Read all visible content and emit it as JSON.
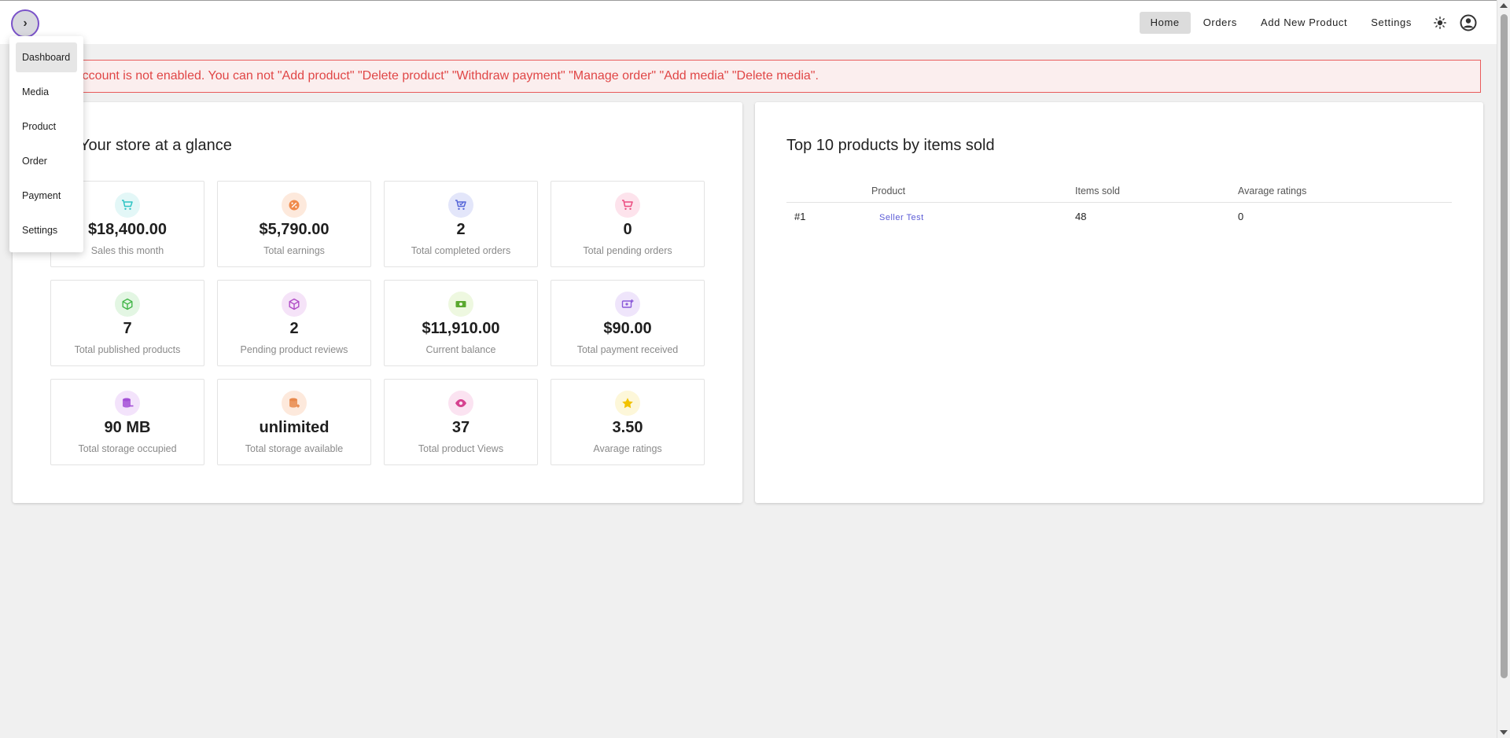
{
  "topbar": {
    "nav": [
      {
        "label": "Home",
        "active": true
      },
      {
        "label": "Orders",
        "active": false
      },
      {
        "label": "Add New Product",
        "active": false
      },
      {
        "label": "Settings",
        "active": false
      }
    ],
    "toggle_glyph": "›"
  },
  "side_menu": {
    "items": [
      "Dashboard",
      "Media",
      "Product",
      "Order",
      "Payment",
      "Settings"
    ]
  },
  "alert": {
    "text": "Your account is not enabled. You can not \"Add product\" \"Delete product\" \"Withdraw payment\" \"Manage order\" \"Add media\" \"Delete media\"."
  },
  "glance": {
    "title": "Your store at a glance",
    "stats": [
      {
        "value": "$18,400.00",
        "label": "Sales this month",
        "icon": "cart-icon",
        "color": "#2ec4c4",
        "bg": "#e3f7f7"
      },
      {
        "value": "$5,790.00",
        "label": "Total earnings",
        "icon": "percent-icon",
        "color": "#f08a4b",
        "bg": "#fde9dc"
      },
      {
        "value": "2",
        "label": "Total completed orders",
        "icon": "cart-check-icon",
        "color": "#5565d8",
        "bg": "#e3e6fa"
      },
      {
        "value": "0",
        "label": "Total pending orders",
        "icon": "cart-icon",
        "color": "#ec4b7f",
        "bg": "#fde3ec"
      },
      {
        "value": "7",
        "label": "Total published products",
        "icon": "box-icon",
        "color": "#43b649",
        "bg": "#e3f6e3"
      },
      {
        "value": "2",
        "label": "Pending product reviews",
        "icon": "box-icon",
        "color": "#b04cc6",
        "bg": "#f5e3f8"
      },
      {
        "value": "$11,910.00",
        "label": "Current balance",
        "icon": "cash-icon",
        "color": "#5aa82f",
        "bg": "#eef8e0"
      },
      {
        "value": "$90.00",
        "label": "Total payment received",
        "icon": "cash-plus-icon",
        "color": "#8b5bd9",
        "bg": "#efe5fb"
      },
      {
        "value": "90 MB",
        "label": "Total storage occupied",
        "icon": "database-icon",
        "color": "#a34fd6",
        "bg": "#f3e3fb"
      },
      {
        "value": "unlimited",
        "label": "Total storage available",
        "icon": "database-plus-icon",
        "color": "#e8894c",
        "bg": "#fde9dc"
      },
      {
        "value": "37",
        "label": "Total product Views",
        "icon": "eye-icon",
        "color": "#d6418f",
        "bg": "#fbe3f1"
      },
      {
        "value": "3.50",
        "label": "Avarage ratings",
        "icon": "star-icon",
        "color": "#f2c200",
        "bg": "#fdf7d9"
      }
    ]
  },
  "top_products": {
    "title": "Top 10 products by items sold",
    "columns": [
      "",
      "Product",
      "Items sold",
      "Avarage ratings"
    ],
    "rows": [
      {
        "rank": "#1",
        "product": "Seller Test",
        "items_sold": "48",
        "ratings": "0"
      }
    ]
  }
}
